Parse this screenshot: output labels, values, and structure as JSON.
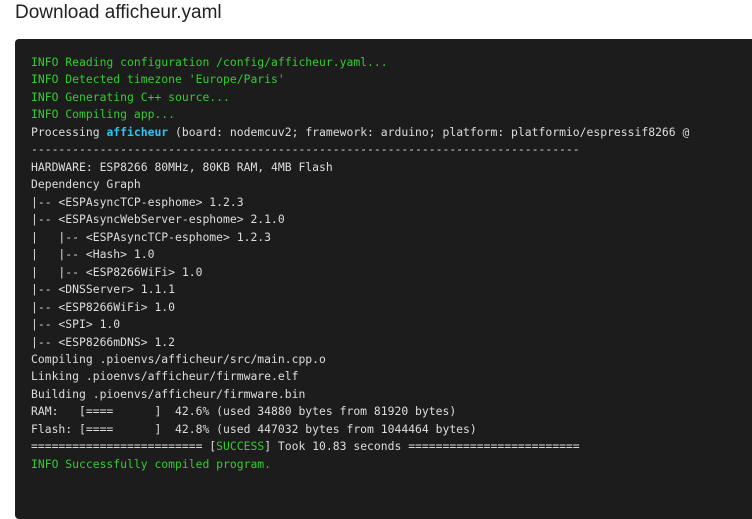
{
  "dialog": {
    "title": "Download afficheur.yaml"
  },
  "log": {
    "lines": [
      {
        "parts": [
          {
            "text": "INFO Reading configuration /config/afficheur.yaml...",
            "color": "green"
          }
        ]
      },
      {
        "parts": [
          {
            "text": "INFO Detected timezone 'Europe/Paris'",
            "color": "green"
          }
        ]
      },
      {
        "parts": [
          {
            "text": "INFO Generating C++ source...",
            "color": "green"
          }
        ]
      },
      {
        "parts": [
          {
            "text": "INFO Compiling app...",
            "color": "green"
          }
        ]
      },
      {
        "parts": [
          {
            "text": "Processing ",
            "color": "default"
          },
          {
            "text": "afficheur",
            "color": "cyan"
          },
          {
            "text": " (board: nodemcuv2; framework: arduino; platform: platformio/espressif8266 @",
            "color": "default"
          }
        ]
      },
      {
        "parts": [
          {
            "text": "--------------------------------------------------------------------------------",
            "color": "default"
          }
        ]
      },
      {
        "parts": [
          {
            "text": "HARDWARE: ESP8266 80MHz, 80KB RAM, 4MB Flash",
            "color": "default"
          }
        ]
      },
      {
        "parts": [
          {
            "text": "Dependency Graph",
            "color": "default"
          }
        ]
      },
      {
        "parts": [
          {
            "text": "|-- <ESPAsyncTCP-esphome> 1.2.3",
            "color": "default"
          }
        ]
      },
      {
        "parts": [
          {
            "text": "|-- <ESPAsyncWebServer-esphome> 2.1.0",
            "color": "default"
          }
        ]
      },
      {
        "parts": [
          {
            "text": "|   |-- <ESPAsyncTCP-esphome> 1.2.3",
            "color": "default"
          }
        ]
      },
      {
        "parts": [
          {
            "text": "|   |-- <Hash> 1.0",
            "color": "default"
          }
        ]
      },
      {
        "parts": [
          {
            "text": "|   |-- <ESP8266WiFi> 1.0",
            "color": "default"
          }
        ]
      },
      {
        "parts": [
          {
            "text": "|-- <DNSServer> 1.1.1",
            "color": "default"
          }
        ]
      },
      {
        "parts": [
          {
            "text": "|-- <ESP8266WiFi> 1.0",
            "color": "default"
          }
        ]
      },
      {
        "parts": [
          {
            "text": "|-- <SPI> 1.0",
            "color": "default"
          }
        ]
      },
      {
        "parts": [
          {
            "text": "|-- <ESP8266mDNS> 1.2",
            "color": "default"
          }
        ]
      },
      {
        "parts": [
          {
            "text": "Compiling .pioenvs/afficheur/src/main.cpp.o",
            "color": "default"
          }
        ]
      },
      {
        "parts": [
          {
            "text": "Linking .pioenvs/afficheur/firmware.elf",
            "color": "default"
          }
        ]
      },
      {
        "parts": [
          {
            "text": "Building .pioenvs/afficheur/firmware.bin",
            "color": "default"
          }
        ]
      },
      {
        "parts": [
          {
            "text": "RAM:   [====      ]  42.6% (used 34880 bytes from 81920 bytes)",
            "color": "default"
          }
        ]
      },
      {
        "parts": [
          {
            "text": "Flash: [====      ]  42.8% (used 447032 bytes from 1044464 bytes)",
            "color": "default"
          }
        ]
      },
      {
        "parts": [
          {
            "text": "========================= [",
            "color": "default"
          },
          {
            "text": "SUCCESS",
            "color": "green"
          },
          {
            "text": "] Took 10.83 seconds =========================",
            "color": "default"
          }
        ]
      },
      {
        "parts": [
          {
            "text": "INFO Successfully compiled program.",
            "color": "green"
          }
        ]
      }
    ]
  },
  "colors": {
    "terminal_background": "#1c1c1c",
    "text_default": "#dddddd",
    "text_green": "#33cc33",
    "text_cyan": "#31c3f0"
  }
}
